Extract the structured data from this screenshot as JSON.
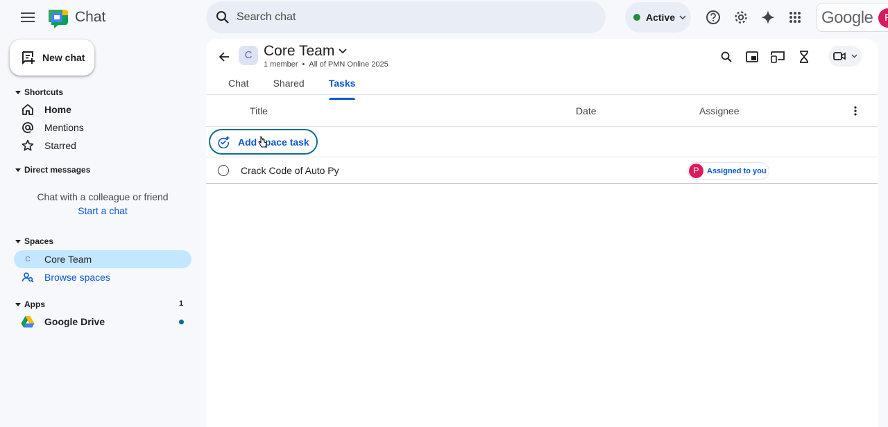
{
  "app": {
    "title": "Chat"
  },
  "search": {
    "placeholder": "Search chat"
  },
  "status": {
    "label": "Active",
    "color": "#1e8e3e"
  },
  "account": {
    "brand": "Google",
    "avatar_letter": "P"
  },
  "sidebar": {
    "new_chat_label": "New chat",
    "shortcuts": {
      "heading": "Shortcuts",
      "items": [
        {
          "label": "Home",
          "icon": "home-icon",
          "bold": true
        },
        {
          "label": "Mentions",
          "icon": "at-icon"
        },
        {
          "label": "Starred",
          "icon": "star-icon"
        }
      ]
    },
    "direct_messages": {
      "heading": "Direct messages",
      "hint": "Chat with a colleague or friend",
      "link": "Start a chat"
    },
    "spaces": {
      "heading": "Spaces",
      "items": [
        {
          "label": "Core Team",
          "avatar_letter": "C",
          "selected": true
        },
        {
          "label": "Browse spaces",
          "icon": "browse-spaces-icon"
        }
      ]
    },
    "apps": {
      "heading": "Apps",
      "count": "1",
      "items": [
        {
          "label": "Google Drive",
          "icon": "google-drive-icon",
          "unread": true
        }
      ]
    }
  },
  "space": {
    "avatar_letter": "C",
    "name": "Core Team",
    "members": "1 member",
    "separator": "•",
    "organization": "All of PMN Online 2025",
    "tabs": [
      {
        "label": "Chat",
        "active": false
      },
      {
        "label": "Shared",
        "active": false
      },
      {
        "label": "Tasks",
        "active": true
      }
    ]
  },
  "tasks": {
    "columns": {
      "title": "Title",
      "date": "Date",
      "assignee": "Assignee"
    },
    "add_label": "Add space task",
    "items": [
      {
        "title": "Crack Code of Auto Py",
        "date": "",
        "assignee_letter": "P",
        "assignee_label": "Assigned to you"
      }
    ]
  },
  "colors": {
    "accent": "#0b57d0",
    "selected_bg": "#c2e7ff",
    "focus_ring": "#0b6e8a",
    "avatar": "#d81b60"
  }
}
